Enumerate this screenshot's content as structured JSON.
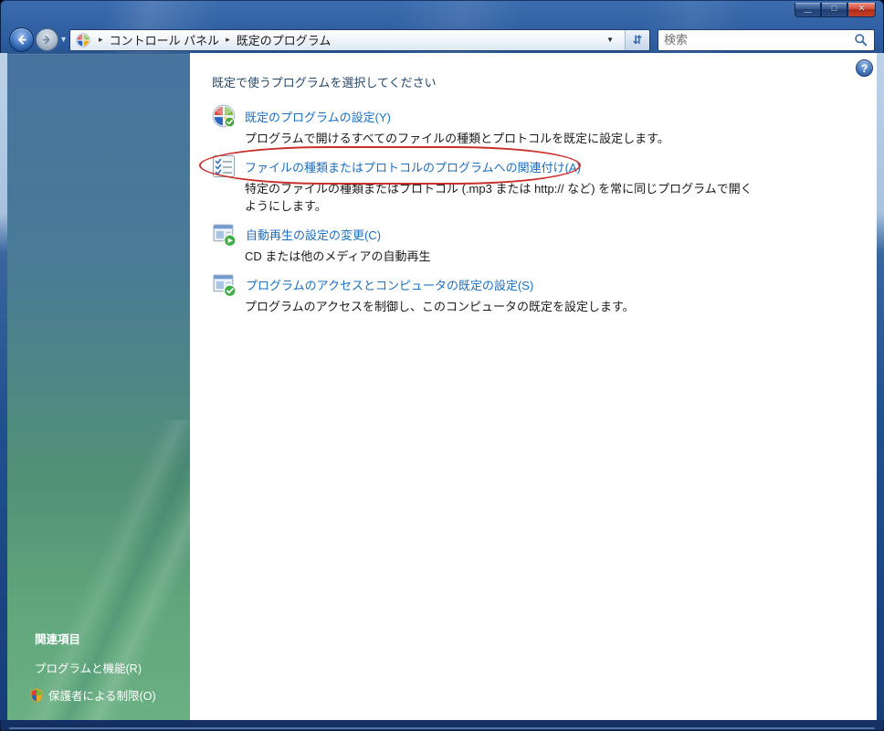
{
  "window": {
    "controls": {
      "minimize_glyph": "—",
      "maximize_glyph": "□",
      "close_glyph": "✕"
    }
  },
  "toolbar": {
    "nav_chevron_glyph": "▾",
    "breadcrumb": {
      "separator": "▸",
      "items": [
        "コントロール パネル",
        "既定のプログラム"
      ]
    },
    "dropdown_glyph": "▼",
    "refresh_glyph": "⇵",
    "search": {
      "placeholder": "検索"
    }
  },
  "help": {
    "glyph": "?"
  },
  "main": {
    "heading": "既定で使うプログラムを選択してください",
    "tasks": [
      {
        "icon": "default-programs-icon",
        "label": "既定のプログラムの設定(Y)",
        "description": "プログラムで開けるすべてのファイルの種類とプロトコルを既定に設定します。"
      },
      {
        "icon": "file-association-icon",
        "label": "ファイルの種類またはプロトコルのプログラムへの関連付け(A)",
        "description": "特定のファイルの種類またはプロトコル (.mp3 または http:// など) を常に同じプログラムで開くようにします。",
        "annotated": true
      },
      {
        "icon": "autoplay-icon",
        "label": "自動再生の設定の変更(C)",
        "description": "CD または他のメディアの自動再生"
      },
      {
        "icon": "program-access-icon",
        "label": "プログラムのアクセスとコンピュータの既定の設定(S)",
        "description": "プログラムのアクセスを制御し、このコンピュータの既定を設定します。"
      }
    ]
  },
  "sidebar": {
    "header": "関連項目",
    "links": [
      {
        "label": "プログラムと機能(R)"
      },
      {
        "label": "保護者による制限(O)",
        "icon": "parental-controls-shield-icon"
      }
    ]
  },
  "annotation": {
    "shape": "ellipse",
    "color": "#c9302c",
    "target": "ファイルの種類またはプロトコルのプログラムへの関連付け(A)"
  },
  "colors": {
    "titlebar_blue": "#2b5b9e",
    "sidebar_top": "#47739f",
    "sidebar_bottom": "#6bb083",
    "link_blue": "#1d6fc0",
    "heading_blue": "#25486b",
    "annotation_red": "#c9302c"
  }
}
